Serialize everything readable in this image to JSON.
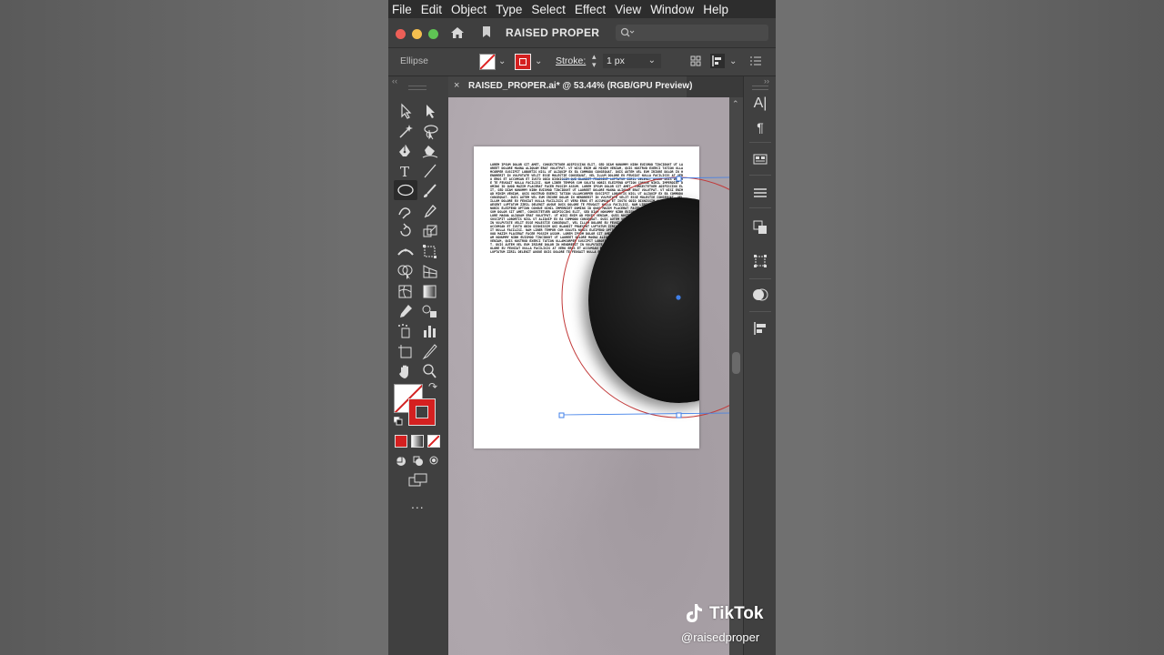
{
  "menu": [
    "File",
    "Edit",
    "Object",
    "Select",
    "Effect",
    "View",
    "Window",
    "Help"
  ],
  "type_menu_label": "Type",
  "appbar": {
    "workspace_name": "RAISED PROPER",
    "search_placeholder": ""
  },
  "controlbar": {
    "selection_type": "Ellipse",
    "stroke_label": "Stroke:",
    "stroke_value": "1 px"
  },
  "document_tab": {
    "title": "RAISED_PROPER.ai* @ 53.44% (RGB/GPU Preview)"
  },
  "toolbar": {
    "more_label": "..."
  },
  "artboard": {
    "lorem": "LOREM IPSUM DOLOR SIT AMET, CONSECTETUER ADIPISCING ELIT, SED DIAM NONUMMY NIBH EUISMOD TINCIDUNT UT LAOREET DOLORE MAGNA ALIQUAM ERAT VOLUTPAT. UT WISI ENIM AD MINIM VENIAM, QUIS NOSTRUD EXERCI TATION ULLAMCORPER SUSCIPIT LOBORTIS NISL UT ALIQUIP EX EA COMMODO CONSEQUAT. DUIS AUTEM VEL EUM IRIURE DOLOR IN HENDRERIT IN VULPUTATE VELIT ESSE MOLESTIE CONSEQUAT, VEL ILLUM DOLORE EU FEUGIAT NULLA FACILISIS AT VERO EROS ET ACCUMSAN ET IUSTO ODIO DIGNISSIM QUI BLANDIT PRAESENT LUPTATUM ZZRIL DELENIT AUGUE DUIS DOLORE TE FEUGAIT NULLA FACILISI. NAM LIBER TEMPOR CUM SOLUTA NOBIS ELEIFEND OPTION CONGUE NIHIL IMPERDIET DOMING ID QUOD MAZIM PLACERAT FACER POSSIM ASSUM. LOREM IPSUM DOLOR SIT AMET, CONSECTETUER ADIPISCING ELIT, SED DIAM NONUMMY NIBH EUISMOD TINCIDUNT UT LAOREET DOLORE MAGNA ALIQUAM ERAT VOLUTPAT. UT WISI ENIM AD MINIM VENIAM, QUIS NOSTRUD EXERCI TATION ULLAMCORPER SUSCIPIT LOBORTIS NISL UT ALIQUIP EX EA COMMODO CONSEQUAT. DUIS AUTEM VEL EUM IRIURE DOLOR IN HENDRERIT IN VULPUTATE VELIT ESSE MOLESTIE CONSEQUAT, VEL ILLUM DOLORE EU FEUGIAT NULLA FACILISIS AT VERO EROS ET ACCUMSAN ET IUSTO ODIO DIGNISSIM QUI BLANDIT PRAESENT LUPTATUM ZZRIL DELENIT AUGUE DUIS DOLORE TE FEUGAIT NULLA FACILISI. NAM LIBER TEMPOR CUM SOLUTA NOBIS ELEIFEND OPTION CONGUE NIHIL IMPERDIET DOMING ID QUOD MAZIM PLACERAT FACER POSSIM ASSUM. LOREM IPSUM DOLOR SIT AMET, CONSECTETUER ADIPISCING ELIT, SED DIAM NONUMMY NIBH EUISMOD TINCIDUNT UT LAOREET DOLORE MAGNA ALIQUAM ERAT VOLUTPAT. UT WISI ENIM AD MINIM VENIAM, QUIS NOSTRUD EXERCI TATION ULLAMCORPER SUSCIPIT LOBORTIS NISL UT ALIQUIP EX EA COMMODO CONSEQUAT. DUIS AUTEM VEL EUM IRIURE DOLOR IN HENDRERIT IN VULPUTATE VELIT ESSE MOLESTIE CONSEQUAT, VEL ILLUM DOLORE EU FEUGIAT NULLA FACILISIS AT VERO EROS ET ACCUMSAN ET IUSTO ODIO DIGNISSIM QUI BLANDIT PRAESENT LUPTATUM ZZRIL DELENIT AUGUE DUIS DOLORE TE FEUGAIT NULLA FACILISI. NAM LIBER TEMPOR CUM SOLUTA NOBIS ELEIFEND OPTION CONGUE NIHIL IMPERDIET DOMING ID QUOD MAZIM PLACERAT FACER POSSIM ASSUM. LOREM IPSUM DOLOR SIT AMET, CONSECTETUER ADIPISCING ELIT, SED DIAM NONUMMY NIBH EUISMOD TINCIDUNT UT LAOREET DOLORE MAGNA ALIQUAM ERAT VOLUTPAT. UT WISI ENIM AD MINIM VENIAM, QUIS NOSTRUD EXERCI TATION ULLAMCORPER SUSCIPIT LOBORTIS NISL UT ALIQUIP EX EA COMMODO CONSEQUAT. DUIS AUTEM VEL EUM IRIURE DOLOR IN HENDRERIT IN VULPUTATE VELIT ESSE MOLESTIE CONSEQUAT, VEL ILLUM DOLORE EU FEUGIAT NULLA FACILISIS AT VERO EROS ET ACCUMSAN ET IUSTO ODIO DIGNISSIM QUI BLANDIT PRAESENT LUPTATUM ZZRIL DELENIT AUGUE DUIS DOLORE TE FEUGAIT NULLA FACILISI."
  },
  "overlay": {
    "brand": "TikTok",
    "handle": "@raisedproper"
  },
  "colors": {
    "fill_none_slash": "#d22222",
    "stroke_color": "#d42020",
    "selection_blue": "#3f7fe8",
    "traffic_red": "#ed5f57",
    "traffic_yellow": "#f5bf4f",
    "traffic_green": "#5fc454"
  },
  "icons": {
    "toolbar": [
      "selection-tool-icon",
      "direct-selection-tool-icon",
      "magic-wand-icon",
      "lasso-icon",
      "pen-tool-icon",
      "curvature-tool-icon",
      "type-tool-icon",
      "line-segment-icon",
      "ellipse-tool-icon",
      "paintbrush-icon",
      "shaper-tool-icon",
      "eraser-icon",
      "rotate-tool-icon",
      "scale-tool-icon",
      "width-tool-icon",
      "free-transform-icon",
      "shape-builder-icon",
      "perspective-grid-icon",
      "mesh-tool-icon",
      "gradient-tool-icon",
      "eyedropper-icon",
      "blend-tool-icon",
      "symbol-sprayer-icon",
      "column-graph-icon",
      "artboard-tool-icon",
      "slice-tool-icon",
      "hand-tool-icon",
      "zoom-tool-icon"
    ],
    "right_panel": [
      "character-icon",
      "paragraph-icon",
      "properties-icon",
      "layers-icon",
      "libraries-icon",
      "transform-icon",
      "appearance-icon",
      "align-icon"
    ]
  }
}
